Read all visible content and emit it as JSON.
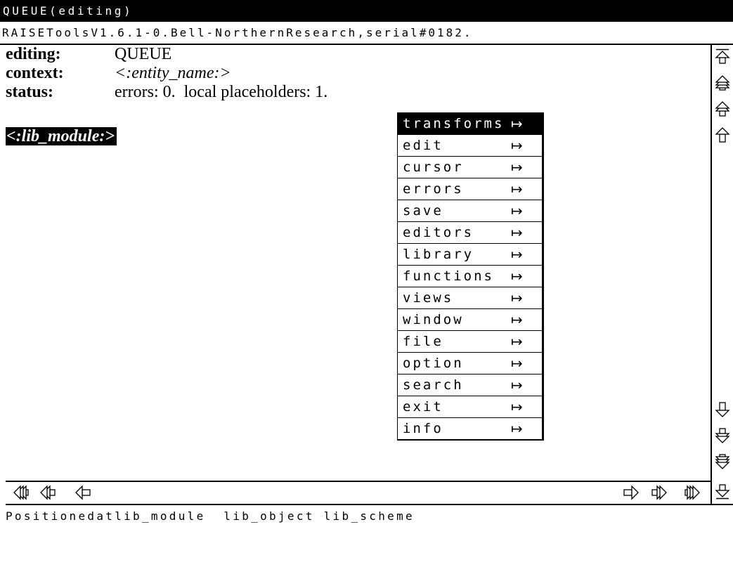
{
  "window": {
    "title": "QUEUE(editing)"
  },
  "banner": {
    "text": "RAISEToolsV1.6.1-0.Bell-NorthernResearch,serial#0182."
  },
  "header": {
    "editing_label": "editing:",
    "editing_value": "QUEUE",
    "context_label": "context:",
    "context_value": "<:entity_name:>",
    "status_label": "status:",
    "status_value": "errors: 0.  local placeholders: 1."
  },
  "document": {
    "placeholder": "<:lib_module:>"
  },
  "menu": {
    "selected_index": 0,
    "submenu_arrow": "↦",
    "items": [
      "transforms",
      "edit",
      "cursor",
      "errors",
      "save",
      "editors",
      "library",
      "functions",
      "views",
      "window",
      "file",
      "option",
      "search",
      "exit",
      "info"
    ]
  },
  "scrollbars": {
    "vertical": {
      "top_icons": [
        "scroll-to-top-icon",
        "triple-up-arrow-icon",
        "double-up-arrow-icon",
        "up-arrow-icon"
      ],
      "bottom_icons": [
        "down-arrow-icon",
        "double-down-arrow-icon",
        "triple-down-arrow-icon",
        "scroll-to-bottom-icon"
      ]
    },
    "horizontal": {
      "left_icons": [
        "triple-left-arrow-icon",
        "double-left-arrow-icon",
        "left-arrow-icon"
      ],
      "right_icons": [
        "right-arrow-icon",
        "double-right-arrow-icon",
        "triple-right-arrow-icon"
      ]
    }
  },
  "message": {
    "text": "Positionedatlib_module  lib_object lib_scheme"
  },
  "colors": {
    "foreground": "#000000",
    "background": "#ffffff",
    "selection_background": "#000000",
    "selection_text": "#ffffff"
  }
}
